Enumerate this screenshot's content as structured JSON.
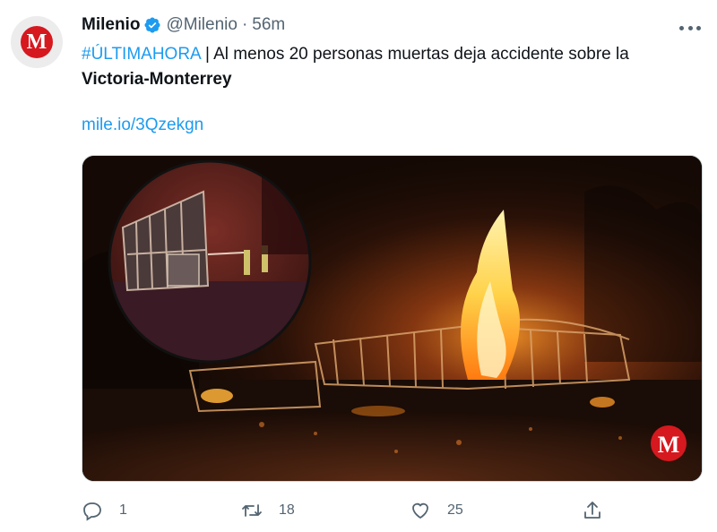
{
  "author": {
    "name": "Milenio",
    "handle": "@Milenio",
    "separator": "·",
    "time": "56m",
    "avatar_letter": "M"
  },
  "tweet": {
    "hashtag": "#ÚLTIMAHORA",
    "text": " | Al menos 20 personas muertas deja accidente sobre la ",
    "bold_text": "Victoria-Monterrey",
    "link": "mile.io/3Qzekgn"
  },
  "media": {
    "watermark": "M",
    "description_icon": "photo"
  },
  "actions": {
    "replies": "1",
    "retweets": "18",
    "likes": "25"
  },
  "colors": {
    "accent": "#1d9bf0",
    "brand_red": "#d6181f",
    "muted": "#536471"
  }
}
